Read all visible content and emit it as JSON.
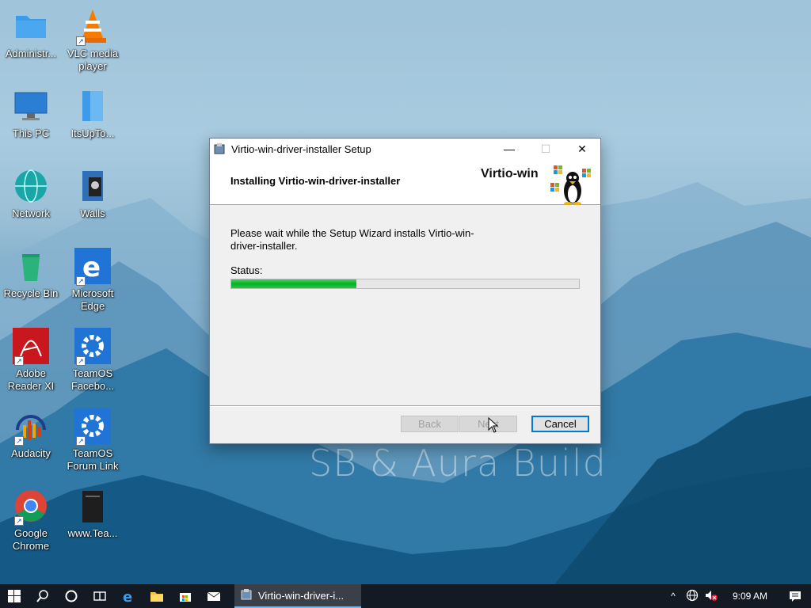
{
  "desktop": {
    "watermark": "SB & Aura Build",
    "icons": [
      {
        "label": "Administr...",
        "icon": "folder-icon"
      },
      {
        "label": "VLC media player",
        "icon": "vlc-icon"
      },
      {
        "label": "This PC",
        "icon": "computer-icon"
      },
      {
        "label": "ItsUpTo...",
        "icon": "document-icon"
      },
      {
        "label": "Network",
        "icon": "network-globe-icon"
      },
      {
        "label": "Walls",
        "icon": "image-file-icon"
      },
      {
        "label": "Recycle Bin",
        "icon": "recycle-bin-icon"
      },
      {
        "label": "Microsoft Edge",
        "icon": "edge-icon"
      },
      {
        "label": "Adobe Reader XI",
        "icon": "adobe-reader-icon"
      },
      {
        "label": "TeamOS Facebo...",
        "icon": "gear-icon"
      },
      {
        "label": "Audacity",
        "icon": "audacity-icon"
      },
      {
        "label": "TeamOS Forum Link",
        "icon": "gear-icon"
      },
      {
        "label": "Google Chrome",
        "icon": "chrome-icon"
      },
      {
        "label": "www.Tea...",
        "icon": "file-icon"
      }
    ]
  },
  "dialog": {
    "title": "Virtio-win-driver-installer Setup",
    "heading": "Installing Virtio-win-driver-installer",
    "brand": "Virtio-win",
    "message": "Please wait while the Setup Wizard installs Virtio-win-driver-installer.",
    "status_label": "Status:",
    "progress": 0.36,
    "buttons": {
      "back": "Back",
      "next": "Next",
      "cancel": "Cancel"
    },
    "controls": {
      "minimize": "—",
      "maximize": "☐",
      "close": "✕"
    }
  },
  "taskbar": {
    "active_window": "Virtio-win-driver-i...",
    "pinned": [
      "start-icon",
      "search-icon",
      "cortana-icon",
      "task-view-icon",
      "edge-icon",
      "file-explorer-icon",
      "store-icon",
      "mail-icon"
    ],
    "tray": {
      "chevron": "^",
      "time": "9:09 AM"
    }
  },
  "colors": {
    "taskbar": "#141a24",
    "progress_fill": "#06b025",
    "accent": "#0078d7"
  }
}
